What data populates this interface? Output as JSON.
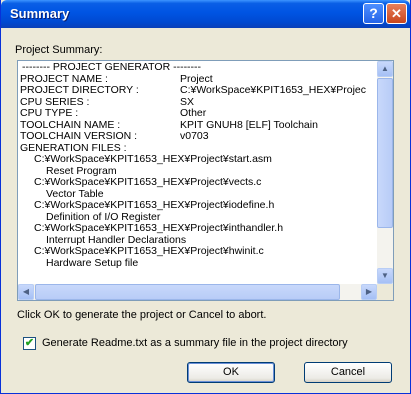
{
  "window": {
    "title": "Summary",
    "help_glyph": "?",
    "close_glyph": "✕"
  },
  "summary_label": "Project Summary:",
  "summary": {
    "header": "-------- PROJECT GENERATOR --------",
    "fields": [
      {
        "key": "PROJECT NAME :",
        "value": "Project"
      },
      {
        "key": "PROJECT DIRECTORY :",
        "value": "C:¥WorkSpace¥KPIT1653_HEX¥Projec"
      },
      {
        "key": "CPU SERIES :",
        "value": "SX"
      },
      {
        "key": "CPU TYPE :",
        "value": "Other"
      },
      {
        "key": "TOOLCHAIN NAME :",
        "value": "KPIT GNUH8 [ELF] Toolchain"
      },
      {
        "key": "TOOLCHAIN VERSION :",
        "value": "v0703"
      }
    ],
    "files_header": "GENERATION FILES :",
    "files": [
      {
        "path": "C:¥WorkSpace¥KPIT1653_HEX¥Project¥start.asm",
        "desc": "Reset Program"
      },
      {
        "path": "C:¥WorkSpace¥KPIT1653_HEX¥Project¥vects.c",
        "desc": "Vector Table"
      },
      {
        "path": "C:¥WorkSpace¥KPIT1653_HEX¥Project¥iodefine.h",
        "desc": "Definition of I/O Register"
      },
      {
        "path": "C:¥WorkSpace¥KPIT1653_HEX¥Project¥inthandler.h",
        "desc": "Interrupt Handler Declarations"
      },
      {
        "path": "C:¥WorkSpace¥KPIT1653_HEX¥Project¥hwinit.c",
        "desc": "Hardware Setup file"
      }
    ]
  },
  "scroll_glyphs": {
    "up": "▲",
    "down": "▼",
    "left": "◀",
    "right": "▶"
  },
  "instruction": "Click OK to generate the project or Cancel to abort.",
  "checkbox": {
    "checked": true,
    "mark": "✔",
    "label": "Generate Readme.txt as a summary file in the project directory"
  },
  "buttons": {
    "ok": "OK",
    "cancel": "Cancel"
  },
  "colors": {
    "titlebar": "#0054e3",
    "dialog_bg": "#ece9d8",
    "close": "#c9461d"
  }
}
